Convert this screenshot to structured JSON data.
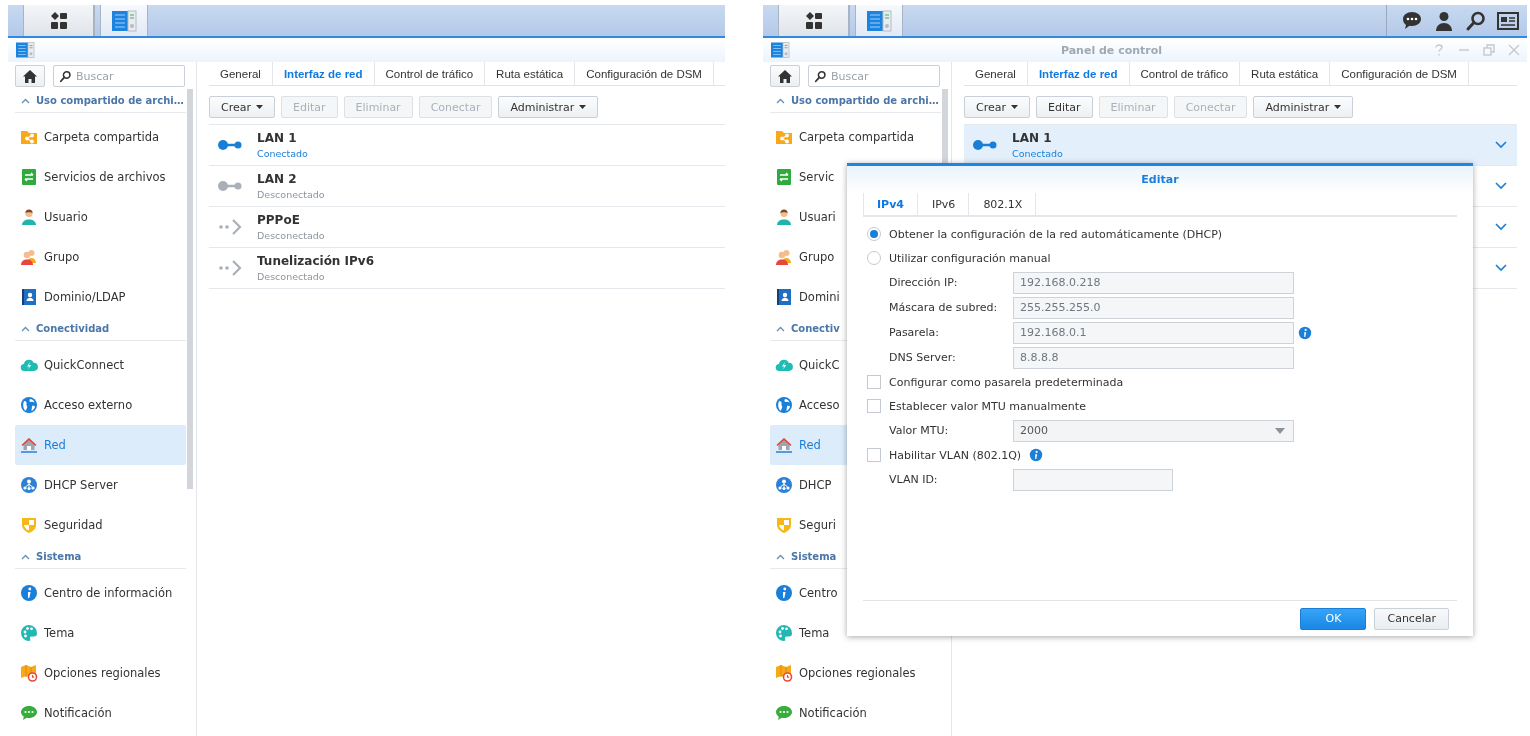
{
  "panels": [
    {
      "taskbar": {
        "buttons": [
          {
            "kind": "apps",
            "selected": false
          },
          {
            "kind": "control-panel",
            "selected": true
          }
        ]
      },
      "sidebar": {
        "search_placeholder": "Buscar",
        "sections": [
          {
            "title": "Uso compartido de archi…",
            "expanded": true,
            "items": [
              {
                "kind": "folder",
                "label": "Carpeta compartida",
                "selected": false
              },
              {
                "kind": "sync",
                "label": "Servicios de archivos",
                "selected": false
              },
              {
                "kind": "user",
                "label": "Usuario",
                "selected": false
              },
              {
                "kind": "group",
                "label": "Grupo",
                "selected": false
              },
              {
                "kind": "directory",
                "label": "Dominio/LDAP",
                "selected": false
              }
            ]
          },
          {
            "title": "Conectividad",
            "expanded": true,
            "items": [
              {
                "kind": "cloud",
                "label": "QuickConnect",
                "selected": false
              },
              {
                "kind": "globe",
                "label": "Acceso externo",
                "selected": false
              },
              {
                "kind": "house",
                "label": "Red",
                "selected": true
              },
              {
                "kind": "hub",
                "label": "DHCP Server",
                "selected": false
              },
              {
                "kind": "shield",
                "label": "Seguridad",
                "selected": false
              }
            ]
          },
          {
            "title": "Sistema",
            "expanded": true,
            "items": [
              {
                "kind": "info",
                "label": "Centro de información",
                "selected": false
              },
              {
                "kind": "palette",
                "label": "Tema",
                "selected": false
              },
              {
                "kind": "map",
                "label": "Opciones regionales",
                "selected": false
              },
              {
                "kind": "chat",
                "label": "Notificación",
                "selected": false
              }
            ]
          }
        ]
      },
      "tabs": [
        {
          "label": "General",
          "selected": false
        },
        {
          "label": "Interfaz de red",
          "selected": true
        },
        {
          "label": "Control de tráfico",
          "selected": false
        },
        {
          "label": "Ruta estática",
          "selected": false
        },
        {
          "label": "Configuración de DSM",
          "selected": false
        }
      ],
      "toolbar": [
        {
          "label": "Crear",
          "menu": true,
          "disabled": false
        },
        {
          "label": "Editar",
          "disabled": true
        },
        {
          "label": "Eliminar",
          "disabled": true
        },
        {
          "label": "Conectar",
          "disabled": true
        },
        {
          "label": "Administrar",
          "menu": true,
          "disabled": false
        }
      ],
      "rows": [
        {
          "kind": "ethernet",
          "name": "LAN 1",
          "status": "Conectado",
          "connected": true,
          "selected": false
        },
        {
          "kind": "ethernet",
          "name": "LAN 2",
          "status": "Desconectado",
          "connected": false,
          "selected": false
        },
        {
          "kind": "tunnel",
          "name": "PPPoE",
          "status": "Desconectado",
          "connected": false,
          "selected": false
        },
        {
          "kind": "tunnel",
          "name": "Tunelización IPv6",
          "status": "Desconectado",
          "connected": false,
          "selected": false
        }
      ]
    },
    {
      "taskbar": {
        "buttons": [
          {
            "kind": "apps",
            "selected": false
          },
          {
            "kind": "control-panel",
            "selected": true
          }
        ],
        "tray": [
          {
            "kind": "chat"
          },
          {
            "kind": "user"
          },
          {
            "kind": "search"
          },
          {
            "kind": "card"
          }
        ]
      },
      "window": {
        "title": "Panel de control",
        "controls": [
          {
            "kind": "help"
          },
          {
            "kind": "minimize"
          },
          {
            "kind": "restore"
          },
          {
            "kind": "close"
          }
        ]
      },
      "sidebar": {
        "search_placeholder": "Buscar",
        "sections": [
          {
            "title": "Uso compartido de archi…",
            "expanded": true,
            "items": [
              {
                "kind": "folder",
                "label": "Carpeta compartida",
                "selected": false
              },
              {
                "kind": "sync",
                "label": "Servic",
                "selected": false
              },
              {
                "kind": "user",
                "label": "Usuari",
                "selected": false
              },
              {
                "kind": "group",
                "label": "Grupo",
                "selected": false
              },
              {
                "kind": "directory",
                "label": "Domini",
                "selected": false
              }
            ]
          },
          {
            "title": "Conectiv",
            "expanded": true,
            "items": [
              {
                "kind": "cloud",
                "label": "QuickC",
                "selected": false
              },
              {
                "kind": "globe",
                "label": "Acceso",
                "selected": false
              },
              {
                "kind": "house",
                "label": "Red",
                "selected": true
              },
              {
                "kind": "hub",
                "label": "DHCP",
                "selected": false
              },
              {
                "kind": "shield",
                "label": "Seguri",
                "selected": false
              }
            ]
          },
          {
            "title": "Sistema",
            "expanded": true,
            "items": [
              {
                "kind": "info",
                "label": "Centro",
                "selected": false
              },
              {
                "kind": "palette",
                "label": "Tema",
                "selected": false
              },
              {
                "kind": "map",
                "label": "Opciones regionales",
                "selected": false
              },
              {
                "kind": "chat",
                "label": "Notificación",
                "selected": false
              }
            ]
          }
        ]
      },
      "tabs": [
        {
          "label": "General",
          "selected": false
        },
        {
          "label": "Interfaz de red",
          "selected": true
        },
        {
          "label": "Control de tráfico",
          "selected": false
        },
        {
          "label": "Ruta estática",
          "selected": false
        },
        {
          "label": "Configuración de DSM",
          "selected": false
        }
      ],
      "toolbar": [
        {
          "label": "Crear",
          "menu": true,
          "disabled": false
        },
        {
          "label": "Editar",
          "disabled": false
        },
        {
          "label": "Eliminar",
          "disabled": true
        },
        {
          "label": "Conectar",
          "disabled": true
        },
        {
          "label": "Administrar",
          "menu": true,
          "disabled": false
        }
      ],
      "rows": [
        {
          "kind": "ethernet",
          "name": "LAN 1",
          "status": "Conectado",
          "connected": true,
          "selected": true,
          "expander": true
        },
        {
          "kind": "covered",
          "selected": false,
          "expander": true
        },
        {
          "kind": "covered",
          "selected": false,
          "expander": true
        },
        {
          "kind": "covered",
          "selected": false,
          "expander": true
        }
      ]
    }
  ],
  "dialog": {
    "title": "Editar",
    "tabs": [
      {
        "label": "IPv4",
        "selected": true
      },
      {
        "label": "IPv6",
        "selected": false
      },
      {
        "label": "802.1X",
        "selected": false
      }
    ],
    "form": [
      {
        "kind": "radio",
        "label": "Obtener la configuración de la red automáticamente (DHCP)",
        "selected": true
      },
      {
        "kind": "radio",
        "label": "Utilizar configuración manual",
        "selected": false
      },
      {
        "kind": "field",
        "label": "Dirección IP:",
        "value": "192.168.0.218",
        "disabled": true
      },
      {
        "kind": "field",
        "label": "Máscara de subred:",
        "value": "255.255.255.0",
        "disabled": true
      },
      {
        "kind": "field",
        "label": "Pasarela:",
        "value": "192.168.0.1",
        "disabled": true,
        "info": true
      },
      {
        "kind": "field",
        "label": "DNS Server:",
        "value": "8.8.8.8",
        "disabled": true
      },
      {
        "kind": "checkbox",
        "label": "Configurar como pasarela predeterminada",
        "checked": false
      },
      {
        "kind": "checkbox",
        "label": "Establecer valor MTU manualmente",
        "checked": false
      },
      {
        "kind": "select",
        "label": "Valor MTU:",
        "value": "2000",
        "disabled": true
      },
      {
        "kind": "checkbox",
        "label": "Habilitar VLAN (802.1Q)",
        "checked": false,
        "info": true
      },
      {
        "kind": "field",
        "label": "VLAN ID:",
        "disabled": true,
        "short": true
      }
    ],
    "buttons": [
      {
        "label": "OK",
        "primary": true
      },
      {
        "label": "Cancelar",
        "primary": false
      }
    ]
  }
}
